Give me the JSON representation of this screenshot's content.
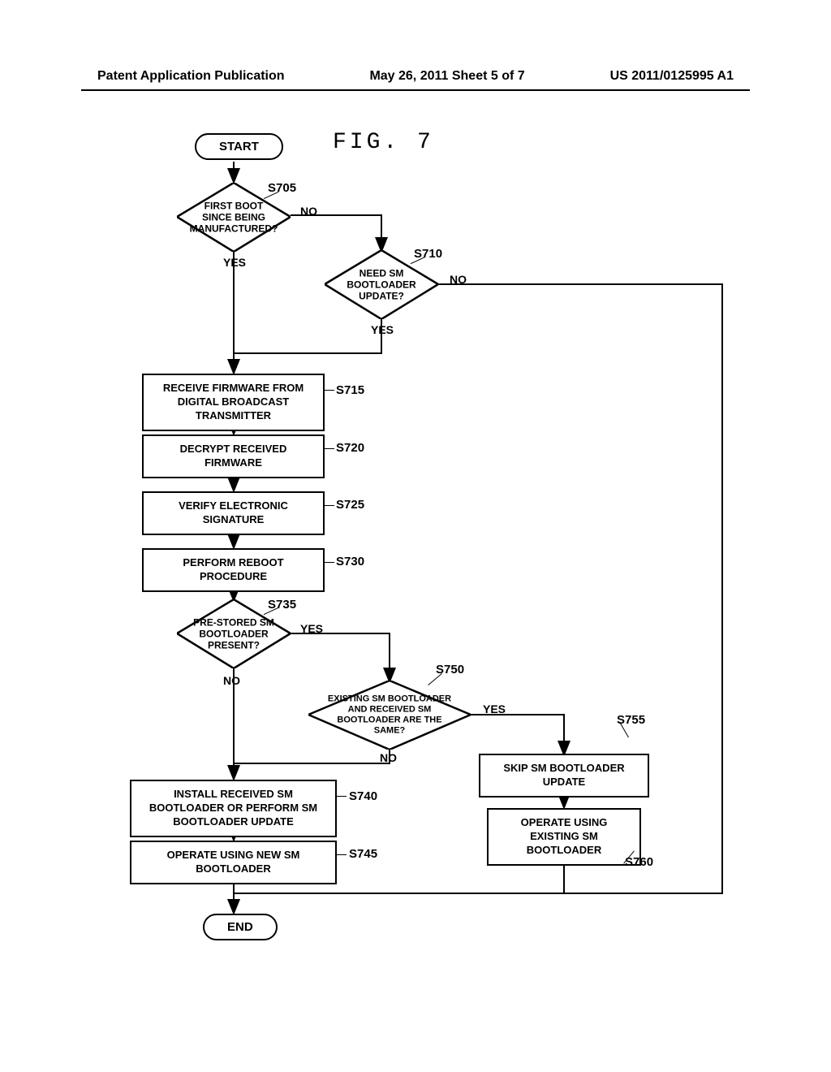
{
  "header": {
    "left": "Patent Application Publication",
    "center": "May 26, 2011  Sheet 5 of 7",
    "right": "US 2011/0125995 A1"
  },
  "figure_title": "FIG. 7",
  "start_label": "START",
  "end_label": "END",
  "steps": {
    "s705": {
      "id": "S705",
      "text": "FIRST BOOT SINCE BEING MANUFACTURED?",
      "yes": "YES",
      "no": "NO"
    },
    "s710": {
      "id": "S710",
      "text": "NEED SM BOOTLOADER UPDATE?",
      "yes": "YES",
      "no": "NO"
    },
    "s715": {
      "id": "S715",
      "text": "RECEIVE FIRMWARE FROM DIGITAL BROADCAST TRANSMITTER"
    },
    "s720": {
      "id": "S720",
      "text": "DECRYPT RECEIVED FIRMWARE"
    },
    "s725": {
      "id": "S725",
      "text": "VERIFY ELECTRONIC SIGNATURE"
    },
    "s730": {
      "id": "S730",
      "text": "PERFORM REBOOT PROCEDURE"
    },
    "s735": {
      "id": "S735",
      "text": "PRE-STORED SM BOOTLOADER PRESENT?",
      "yes": "YES",
      "no": "NO"
    },
    "s740": {
      "id": "S740",
      "text": "INSTALL RECEIVED SM BOOTLOADER OR PERFORM SM BOOTLOADER UPDATE"
    },
    "s745": {
      "id": "S745",
      "text": "OPERATE USING NEW SM BOOTLOADER"
    },
    "s750": {
      "id": "S750",
      "text": "EXISTING SM BOOTLOADER AND RECEIVED SM BOOTLOADER ARE THE SAME?",
      "yes": "YES",
      "no": "NO"
    },
    "s755": {
      "id": "S755",
      "text": "SKIP SM BOOTLOADER UPDATE"
    },
    "s760": {
      "id": "S760",
      "text": "OPERATE USING EXISTING SM BOOTLOADER"
    }
  },
  "chart_data": {
    "type": "flowchart",
    "nodes": [
      {
        "id": "start",
        "type": "terminal",
        "label": "START"
      },
      {
        "id": "S705",
        "type": "decision",
        "label": "FIRST BOOT SINCE BEING MANUFACTURED?"
      },
      {
        "id": "S710",
        "type": "decision",
        "label": "NEED SM BOOTLOADER UPDATE?"
      },
      {
        "id": "S715",
        "type": "process",
        "label": "RECEIVE FIRMWARE FROM DIGITAL BROADCAST TRANSMITTER"
      },
      {
        "id": "S720",
        "type": "process",
        "label": "DECRYPT RECEIVED FIRMWARE"
      },
      {
        "id": "S725",
        "type": "process",
        "label": "VERIFY ELECTRONIC SIGNATURE"
      },
      {
        "id": "S730",
        "type": "process",
        "label": "PERFORM REBOOT PROCEDURE"
      },
      {
        "id": "S735",
        "type": "decision",
        "label": "PRE-STORED SM BOOTLOADER PRESENT?"
      },
      {
        "id": "S740",
        "type": "process",
        "label": "INSTALL RECEIVED SM BOOTLOADER OR PERFORM SM BOOTLOADER UPDATE"
      },
      {
        "id": "S745",
        "type": "process",
        "label": "OPERATE USING NEW SM BOOTLOADER"
      },
      {
        "id": "S750",
        "type": "decision",
        "label": "EXISTING SM BOOTLOADER AND RECEIVED SM BOOTLOADER ARE THE SAME?"
      },
      {
        "id": "S755",
        "type": "process",
        "label": "SKIP SM BOOTLOADER UPDATE"
      },
      {
        "id": "S760",
        "type": "process",
        "label": "OPERATE USING EXISTING SM BOOTLOADER"
      },
      {
        "id": "end",
        "type": "terminal",
        "label": "END"
      }
    ],
    "edges": [
      {
        "from": "start",
        "to": "S705"
      },
      {
        "from": "S705",
        "to": "S715",
        "label": "YES"
      },
      {
        "from": "S705",
        "to": "S710",
        "label": "NO"
      },
      {
        "from": "S710",
        "to": "S715",
        "label": "YES"
      },
      {
        "from": "S710",
        "to": "end",
        "label": "NO"
      },
      {
        "from": "S715",
        "to": "S720"
      },
      {
        "from": "S720",
        "to": "S725"
      },
      {
        "from": "S725",
        "to": "S730"
      },
      {
        "from": "S730",
        "to": "S735"
      },
      {
        "from": "S735",
        "to": "S740",
        "label": "NO"
      },
      {
        "from": "S735",
        "to": "S750",
        "label": "YES"
      },
      {
        "from": "S740",
        "to": "S745"
      },
      {
        "from": "S745",
        "to": "end"
      },
      {
        "from": "S750",
        "to": "S740",
        "label": "NO"
      },
      {
        "from": "S750",
        "to": "S755",
        "label": "YES"
      },
      {
        "from": "S755",
        "to": "S760"
      },
      {
        "from": "S760",
        "to": "end"
      }
    ]
  }
}
